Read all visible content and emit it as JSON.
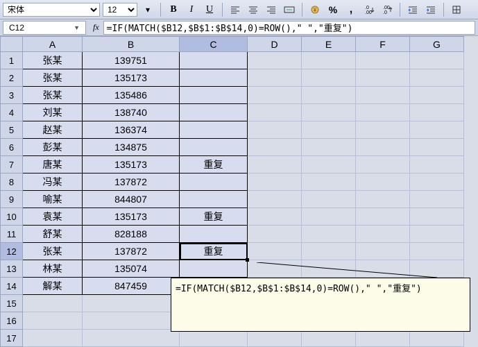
{
  "toolbar": {
    "font_name": "宋体",
    "font_size": "12",
    "bold": "B",
    "italic": "I",
    "underline": "U"
  },
  "formula_bar": {
    "name_box": "C12",
    "fx": "fx",
    "formula": "=IF(MATCH($B12,$B$1:$B$14,0)=ROW(),\" \",\"重复\")"
  },
  "columns": [
    "A",
    "B",
    "C",
    "D",
    "E",
    "F",
    "G"
  ],
  "rows": [
    {
      "n": "1",
      "a": "张某",
      "b": "139751",
      "c": ""
    },
    {
      "n": "2",
      "a": "张某",
      "b": "135173",
      "c": ""
    },
    {
      "n": "3",
      "a": "张某",
      "b": "135486",
      "c": ""
    },
    {
      "n": "4",
      "a": "刘某",
      "b": "138740",
      "c": ""
    },
    {
      "n": "5",
      "a": "赵某",
      "b": "136374",
      "c": ""
    },
    {
      "n": "6",
      "a": "彭某",
      "b": "134875",
      "c": ""
    },
    {
      "n": "7",
      "a": "唐某",
      "b": "135173",
      "c": "重复"
    },
    {
      "n": "8",
      "a": "冯某",
      "b": "137872",
      "c": ""
    },
    {
      "n": "9",
      "a": "喻某",
      "b": "844807",
      "c": ""
    },
    {
      "n": "10",
      "a": "袁某",
      "b": "135173",
      "c": "重复"
    },
    {
      "n": "11",
      "a": "舒某",
      "b": "828188",
      "c": ""
    },
    {
      "n": "12",
      "a": "张某",
      "b": "137872",
      "c": "重复"
    },
    {
      "n": "13",
      "a": "林某",
      "b": "135074",
      "c": ""
    },
    {
      "n": "14",
      "a": "解某",
      "b": "847459",
      "c": ""
    },
    {
      "n": "15",
      "a": "",
      "b": "",
      "c": ""
    },
    {
      "n": "16",
      "a": "",
      "b": "",
      "c": ""
    },
    {
      "n": "17",
      "a": "",
      "b": "",
      "c": ""
    }
  ],
  "tooltip": "=IF(MATCH($B12,$B$1:$B$14,0)=ROW(),\" \",\"重复\")"
}
